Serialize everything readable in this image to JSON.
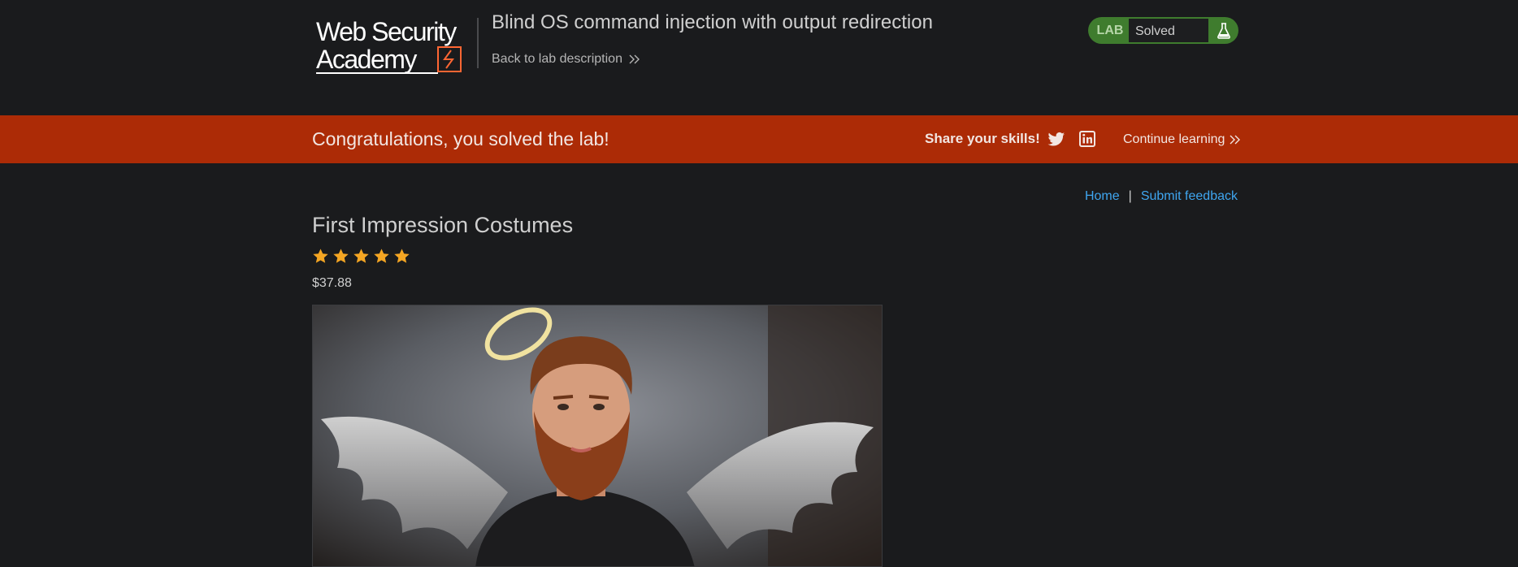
{
  "header": {
    "logo_alt": "Web Security Academy",
    "lab_title": "Blind OS command injection with output redirection",
    "back_link": "Back to lab description",
    "status_tag": "LAB",
    "status_text": "Solved"
  },
  "banner": {
    "message": "Congratulations, you solved the lab!",
    "share_label": "Share your skills!",
    "continue_label": "Continue learning"
  },
  "nav": {
    "home": "Home",
    "separator": "|",
    "feedback": "Submit feedback"
  },
  "product": {
    "title": "First Impression Costumes",
    "rating": 5,
    "rating_max": 5,
    "price": "$37.88"
  },
  "colors": {
    "background": "#1a1b1d",
    "banner": "#ac2b06",
    "solved_green": "#3f7c2e",
    "link_blue": "#3fa6f0",
    "star": "#f5a623"
  },
  "icons": [
    "twitter-icon",
    "linkedin-icon",
    "flask-icon",
    "double-chevron-icon",
    "star-icon"
  ]
}
